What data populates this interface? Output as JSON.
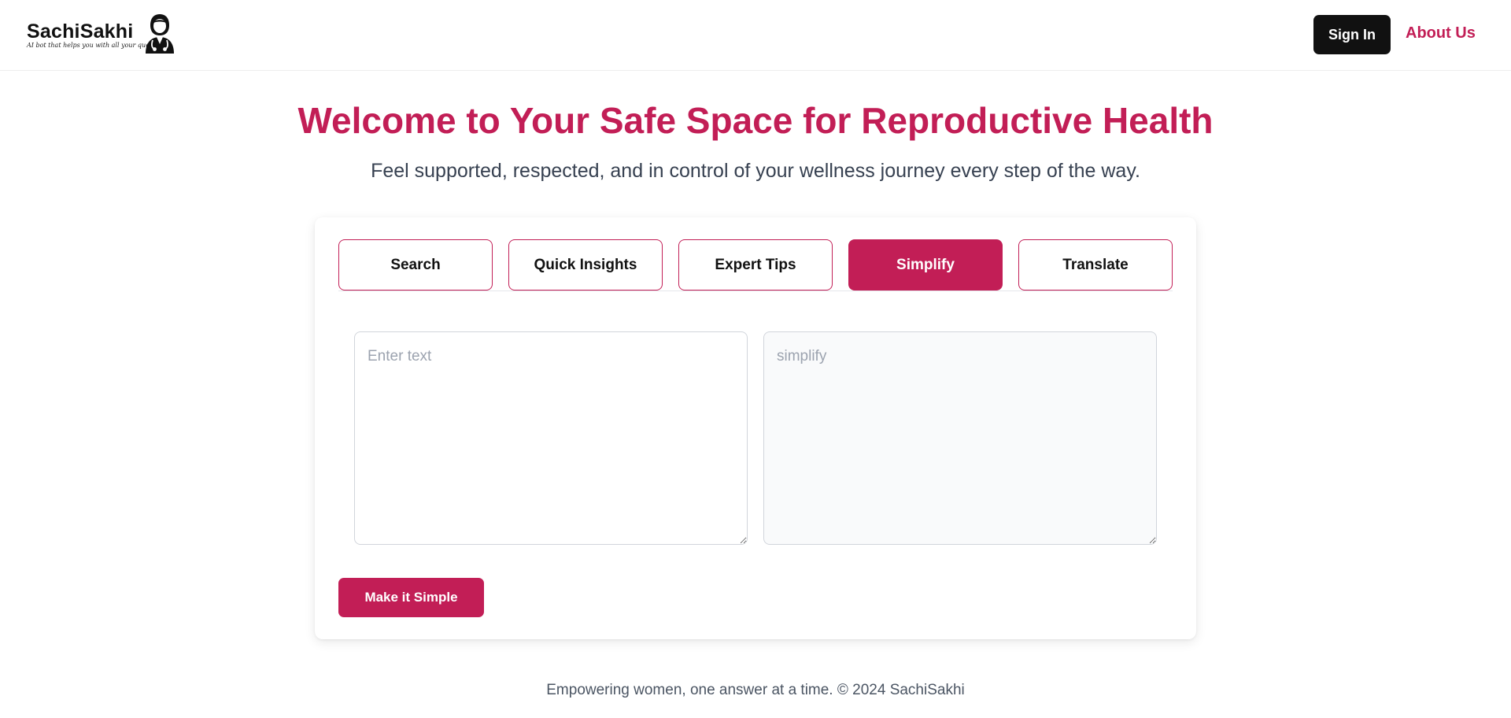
{
  "header": {
    "brand_name": "SachiSakhi",
    "brand_tagline": "AI bot that helps you with all your queries",
    "brand_icon": "doctor-icon",
    "signin_label": "Sign In",
    "about_label": "About Us"
  },
  "hero": {
    "title": "Welcome to Your Safe Space for Reproductive Health",
    "subtitle": "Feel supported, respected, and in control of your wellness journey every step of the way."
  },
  "tabs": [
    {
      "label": "Search",
      "active": false
    },
    {
      "label": "Quick Insights",
      "active": false
    },
    {
      "label": "Expert Tips",
      "active": false
    },
    {
      "label": "Simplify",
      "active": true
    },
    {
      "label": "Translate",
      "active": false
    }
  ],
  "simplify": {
    "input_placeholder": "Enter text",
    "input_value": "",
    "output_placeholder": "simplify",
    "output_value": "",
    "action_label": "Make it Simple"
  },
  "footer": {
    "text": "Empowering women, one answer at a time. © 2024 SachiSakhi"
  },
  "colors": {
    "accent": "#c21e56",
    "dark_button": "#111111",
    "output_bg": "#f9fafb"
  }
}
